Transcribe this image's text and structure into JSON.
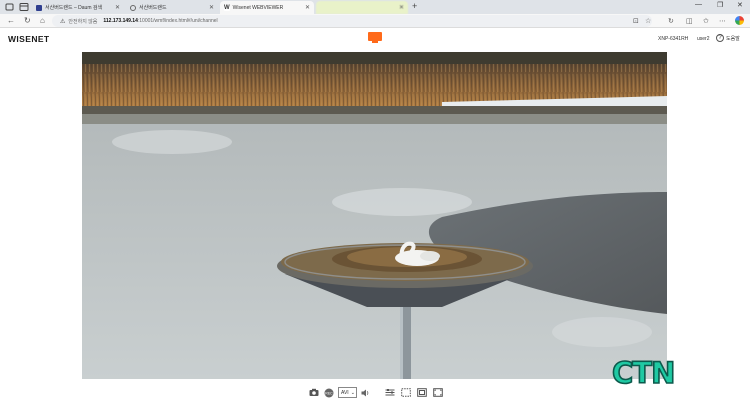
{
  "browser": {
    "tabs": [
      {
        "label": "서산버드랜드 – Daum 검색",
        "state": "inactive"
      },
      {
        "label": "서산버드랜드",
        "state": "inactive"
      },
      {
        "label": "Wisenet WEBVIEWER",
        "state": "active"
      }
    ],
    "new_tab_icon": "plus-icon",
    "window_controls": {
      "minimize": "—",
      "restore": "❐",
      "close": "✕"
    },
    "address": {
      "security_label": "안전하지 않음",
      "host": "112.173.149.14",
      "path": ":10001/wmf/index.html#/uni/channel"
    }
  },
  "app": {
    "logo": "WISENET",
    "live_icon": "monitor-icon",
    "model": "XNP-6341RH",
    "user": "user2",
    "help_label": "도움말"
  },
  "controls": {
    "codec_select": "AVI",
    "icons": [
      "camera-icon",
      "record-icon",
      "volume-icon",
      "adjust-icon",
      "fit-icon",
      "original-size-icon",
      "fullscreen-icon"
    ]
  },
  "watermark": "CTN",
  "colors": {
    "accent": "#ff6a1a",
    "watermark_fill": "#1fc9a3",
    "watermark_stroke": "#0c5a4c"
  }
}
